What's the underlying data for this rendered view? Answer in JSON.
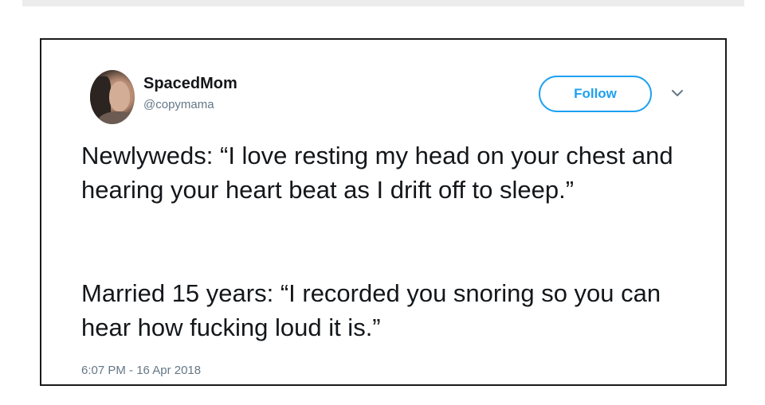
{
  "tweet": {
    "display_name": "SpacedMom",
    "handle": "@copymama",
    "follow_label": "Follow",
    "paragraphs": [
      "Newlyweds: “I love resting my head on your chest and hearing your heart beat as I drift off to sleep.”",
      "Married 15 years: “I recorded you snoring so you can hear how fucking loud it is.”"
    ],
    "timestamp": "6:07 PM - 16 Apr 2018"
  },
  "icons": {
    "menu": "chevron-down-icon"
  },
  "colors": {
    "accent": "#1da1f2",
    "text": "#14171a",
    "muted": "#657786"
  }
}
